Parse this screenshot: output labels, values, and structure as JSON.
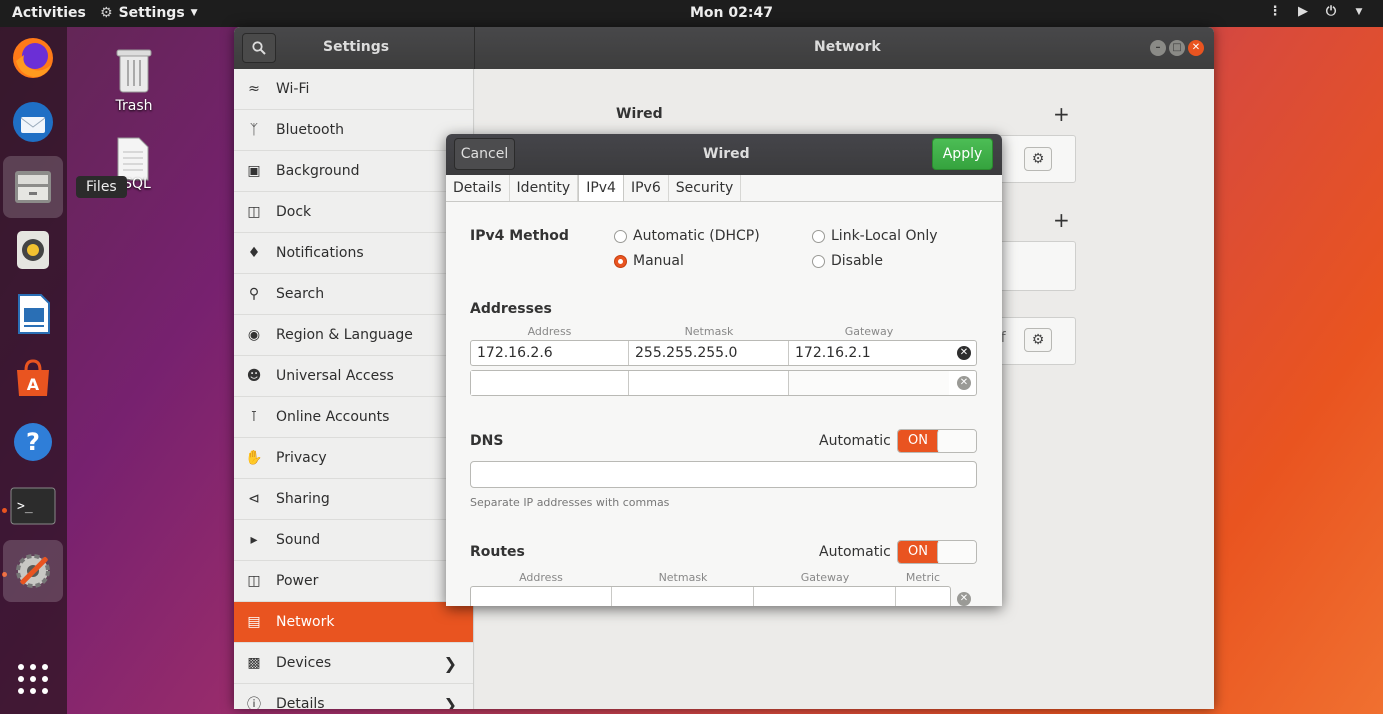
{
  "topbar": {
    "activities": "Activities",
    "app_menu": "Settings",
    "clock": "Mon 02:47"
  },
  "desktop": {
    "trash_label": "Trash",
    "file_label": "SQL",
    "tooltip": "Files"
  },
  "window": {
    "sidebar_title": "Settings",
    "content_title": "Network",
    "sidebar": {
      "items": [
        {
          "label": "Wi-Fi",
          "icon": "wifi-icon"
        },
        {
          "label": "Bluetooth",
          "icon": "bluetooth-icon"
        },
        {
          "label": "Background",
          "icon": "background-icon"
        },
        {
          "label": "Dock",
          "icon": "dock-icon"
        },
        {
          "label": "Notifications",
          "icon": "bell-icon"
        },
        {
          "label": "Search",
          "icon": "search-icon"
        },
        {
          "label": "Region & Language",
          "icon": "camera-icon"
        },
        {
          "label": "Universal Access",
          "icon": "accessibility-icon"
        },
        {
          "label": "Online Accounts",
          "icon": "online-accounts-icon"
        },
        {
          "label": "Privacy",
          "icon": "hand-icon"
        },
        {
          "label": "Sharing",
          "icon": "share-icon"
        },
        {
          "label": "Sound",
          "icon": "speaker-icon"
        },
        {
          "label": "Power",
          "icon": "power-icon"
        },
        {
          "label": "Network",
          "icon": "network-icon"
        },
        {
          "label": "Devices",
          "icon": "devices-icon"
        },
        {
          "label": "Details",
          "icon": "details-icon"
        }
      ]
    },
    "main": {
      "wired_heading": "Wired",
      "partial_off": "ff"
    }
  },
  "dialog": {
    "cancel": "Cancel",
    "title": "Wired",
    "apply": "Apply",
    "tabs": [
      "Details",
      "Identity",
      "IPv4",
      "IPv6",
      "Security"
    ],
    "ipv4_method_label": "IPv4 Method",
    "methods": {
      "auto": "Automatic (DHCP)",
      "link_local": "Link-Local Only",
      "manual": "Manual",
      "disable": "Disable"
    },
    "selected_method": "Manual",
    "addresses_label": "Addresses",
    "address_cols": [
      "Address",
      "Netmask",
      "Gateway"
    ],
    "address_rows": [
      {
        "address": "172.16.2.6",
        "netmask": "255.255.255.0",
        "gateway": "172.16.2.1"
      },
      {
        "address": "",
        "netmask": "",
        "gateway": ""
      }
    ],
    "dns_label": "DNS",
    "dns_auto_label": "Automatic",
    "dns_toggle": "ON",
    "dns_value": "",
    "dns_hint": "Separate IP addresses with commas",
    "routes_label": "Routes",
    "routes_auto_label": "Automatic",
    "routes_toggle": "ON",
    "route_cols": [
      "Address",
      "Netmask",
      "Gateway",
      "Metric"
    ]
  },
  "colors": {
    "accent": "#e95420",
    "apply_green": "#3aaa42"
  }
}
